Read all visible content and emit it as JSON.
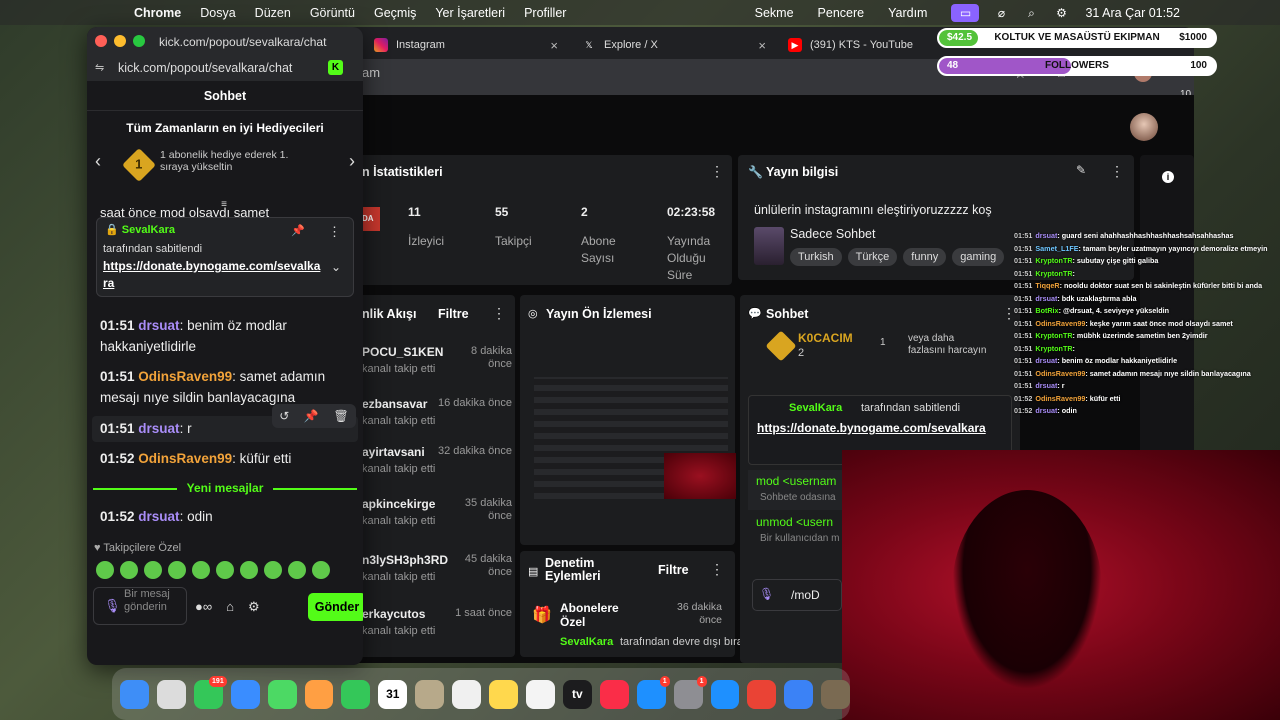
{
  "menubar": {
    "app": "Chrome",
    "items": [
      "Dosya",
      "Düzen",
      "Görüntü",
      "Geçmiş",
      "Yer İşaretleri",
      "Profiller"
    ],
    "right_items": [
      "Sekme",
      "Pencere",
      "Yardım"
    ],
    "clock": "31 Ara Çar  01:52"
  },
  "browser": {
    "tabs": [
      {
        "title": "Instagram",
        "icon": "instagram-icon"
      },
      {
        "title": "Explore / X",
        "icon": "x-icon"
      },
      {
        "title": "(391) KTS - YouTube",
        "icon": "youtube-icon"
      }
    ],
    "url_fragment": "am",
    "tab_count": "10"
  },
  "dashboard": {
    "stats_title": "n İstatistikleri",
    "stats": [
      {
        "value": "11",
        "label": "İzleyici"
      },
      {
        "value": "55",
        "label": "Takipçi"
      },
      {
        "value": "2",
        "label": "Abone Sayısı"
      },
      {
        "value": "02:23:58",
        "label": "Yayında Olduğu Süre"
      }
    ],
    "stream_info": {
      "title": "Yayın bilgisi",
      "stream_title": "ünlülerin instagramını eleştiriyoruzzzzz koş",
      "category": "Sadece Sohbet",
      "tags": [
        "Turkish",
        "Türkçe",
        "funny",
        "gaming"
      ]
    },
    "activity": {
      "title": "nlik Akışı",
      "filter": "Filtre",
      "rows": [
        {
          "name": "POCU_S1KEN",
          "action": "kanalı takip etti",
          "time": "8 dakika önce"
        },
        {
          "name": "ezbansavar",
          "action": "kanalı takip etti",
          "time": "16 dakika önce"
        },
        {
          "name": "ayirtavsani",
          "action": "kanalı takip etti",
          "time": "32 dakika önce"
        },
        {
          "name": "apkincekirge",
          "action": "kanalı takip etti",
          "time": "35 dakika önce"
        },
        {
          "name": "n3lySH3ph3RD",
          "action": "kanalı takip etti",
          "time": "45 dakika önce"
        },
        {
          "name": "erkaycutos",
          "action": "kanalı takip etti",
          "time": "1 saat önce"
        }
      ]
    },
    "preview": {
      "title": "Yayın Ön İzlemesi"
    },
    "moderation": {
      "title": "Denetim Eylemleri",
      "filter": "Filtre",
      "item_title": "Abonelere Özel",
      "item_time": "36 dakika önce",
      "item_user": "SevalKara",
      "item_text": "tarafından devre dışı bırakıldı"
    },
    "chat": {
      "title": "Sohbet",
      "top_gifter": "K0CACIM",
      "gift_count": "2",
      "gift_note_count": "1",
      "gift_note": "veya daha fazlasını harcayın",
      "pinned_user": "SevalKara",
      "pinned_by": "tarafından sabitlendi",
      "pinned_link": "https://donate.bynogame.com/sevalkara",
      "cmd1": "mod <usernam",
      "cmd1_desc": "Sohbete odasına",
      "cmd2": "unmod <usern",
      "cmd2_desc": "Bir kullanıcıdan m",
      "input_value": "/moD"
    }
  },
  "popout": {
    "window_title": "kick.com/popout/sevalkara/chat",
    "url": "kick.com/popout/sevalkara/chat",
    "header": "Sohbet",
    "gift_title": "Tüm Zamanların en iyi Hediyecileri",
    "gift_rank": "1",
    "gift_text": "1 abonelik hediye ederek 1. sıraya yükseltin",
    "partial_msg": "saat önce mod olsaydı samet",
    "pinned": {
      "user": "SevalKara",
      "by": "tarafından sabitlendi",
      "link": "https://donate.bynogame.com/sevalkara"
    },
    "messages": [
      {
        "time": "01:51",
        "user": "drsuat",
        "color": "purple",
        "text": "benim öz modlar hakkaniyetlidirle"
      },
      {
        "time": "01:51",
        "user": "OdinsRaven99",
        "color": "orange",
        "text": "samet adamın mesajı nıye sildin banlayacagına"
      },
      {
        "time": "01:51",
        "user": "drsuat",
        "color": "purple",
        "text": "r"
      },
      {
        "time": "01:52",
        "user": "OdinsRaven99",
        "color": "orange",
        "text": "küfür etti"
      },
      {
        "time": "01:52",
        "user": "drsuat",
        "color": "purple",
        "text": "odin"
      }
    ],
    "new_messages_label": "Yeni mesajlar",
    "emote_label": "Takipçilere Özel",
    "input_placeholder": "Bir mesaj gönderin",
    "send_label": "Gönder"
  },
  "overlays": {
    "goal1": {
      "start": "$42.5",
      "label": "KOLTUK VE MASAÜSTÜ EKIPMAN",
      "end": "$1000",
      "progress": 0.0425,
      "color": "#53c23a"
    },
    "goal2": {
      "start": "48",
      "label": "FOLLOWERS",
      "end": "100",
      "progress": 0.48,
      "color": "#a056c8"
    },
    "chat_lines": [
      {
        "t": "01:51",
        "u": "drsuat",
        "c": "u1",
        "m": "guard seni ahahhashhashhashhashsahsahhashas"
      },
      {
        "t": "01:51",
        "u": "Samet_L1FE",
        "c": "u4",
        "m": "tamam beyler uzatmayın yayıncıyı demoralize etmeyin"
      },
      {
        "t": "01:51",
        "u": "KryptonTR",
        "c": "u3",
        "m": "subutay çişe gitti galiba"
      },
      {
        "t": "01:51",
        "u": "KryptonTR",
        "c": "u3",
        "m": ""
      },
      {
        "t": "01:51",
        "u": "TiqqeR",
        "c": "u2",
        "m": "nooldu doktor suat sen bi sakinleştin küfürler bitti bi anda"
      },
      {
        "t": "01:51",
        "u": "drsuat",
        "c": "u1",
        "m": "bdk uzaklaştırma abla"
      },
      {
        "t": "01:51",
        "u": "BotRix",
        "c": "u3",
        "m": "@drsuat, 4. seviyeye yükseldin"
      },
      {
        "t": "01:51",
        "u": "OdinsRaven99",
        "c": "u2",
        "m": "keşke yarım saat önce mod olsaydı samet"
      },
      {
        "t": "01:51",
        "u": "KryptonTR",
        "c": "u3",
        "m": "mübhk üzerimde sametim ben 2yimdir"
      },
      {
        "t": "01:51",
        "u": "KryptonTR",
        "c": "u3",
        "m": ""
      },
      {
        "t": "01:51",
        "u": "drsuat",
        "c": "u1",
        "m": "benim öz modlar hakkaniyetlidirle"
      },
      {
        "t": "01:51",
        "u": "OdinsRaven99",
        "c": "u2",
        "m": "samet adamın mesajı nıye sildin banlayacagına"
      },
      {
        "t": "01:51",
        "u": "drsuat",
        "c": "u1",
        "m": "r"
      },
      {
        "t": "01:52",
        "u": "OdinsRaven99",
        "c": "u2",
        "m": "küfür etti"
      },
      {
        "t": "01:52",
        "u": "drsuat",
        "c": "u1",
        "m": "odin"
      }
    ]
  },
  "dock": {
    "apps": [
      {
        "name": "finder-icon",
        "color": "#3e8ef7",
        "badge": ""
      },
      {
        "name": "launchpad-icon",
        "color": "#dcdcdc",
        "badge": ""
      },
      {
        "name": "messages-icon",
        "color": "#34c759",
        "badge": "191"
      },
      {
        "name": "mail-icon",
        "color": "#3a8dff",
        "badge": ""
      },
      {
        "name": "maps-icon",
        "color": "#4cd964",
        "badge": ""
      },
      {
        "name": "photos-icon",
        "color": "#ff9f43",
        "badge": ""
      },
      {
        "name": "facetime-icon",
        "color": "#34c759",
        "badge": ""
      },
      {
        "name": "calendar-icon",
        "color": "#ffffff",
        "badge": "",
        "label": "31"
      },
      {
        "name": "contacts-icon",
        "color": "#b7a98a",
        "badge": ""
      },
      {
        "name": "reminders-icon",
        "color": "#f0f0f0",
        "badge": ""
      },
      {
        "name": "notes-icon",
        "color": "#ffd84d",
        "badge": ""
      },
      {
        "name": "freeform-icon",
        "color": "#f4f4f4",
        "badge": ""
      },
      {
        "name": "appletv-icon",
        "color": "#1c1c1e",
        "badge": "",
        "label": "tv"
      },
      {
        "name": "music-icon",
        "color": "#fa2d48",
        "badge": ""
      },
      {
        "name": "appstore-icon",
        "color": "#1e90ff",
        "badge": "1"
      },
      {
        "name": "settings-icon",
        "color": "#8e8e93",
        "badge": "1"
      },
      {
        "name": "safari-icon",
        "color": "#1e90ff",
        "badge": ""
      },
      {
        "name": "chrome-icon",
        "color": "#ea4335",
        "badge": ""
      },
      {
        "name": "preview-icon",
        "color": "#3b82f6",
        "badge": ""
      },
      {
        "name": "photo-thumb-icon",
        "color": "#7a6a52",
        "badge": ""
      }
    ]
  }
}
